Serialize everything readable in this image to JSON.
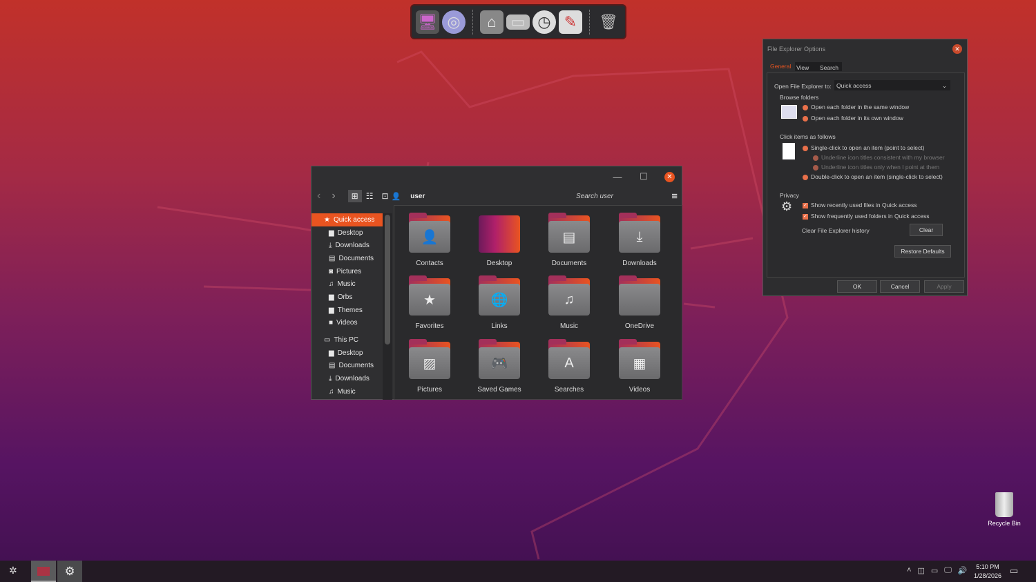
{
  "dock": {
    "items": [
      "monitor",
      "network-globe",
      "home-folder",
      "drive",
      "clock",
      "settings-tools",
      "trash"
    ]
  },
  "explorer": {
    "location": "user",
    "search_placeholder": "Search user",
    "sidebar": [
      {
        "label": "Quick access",
        "icon": "★",
        "active": true
      },
      {
        "label": "Desktop",
        "icon": "▆"
      },
      {
        "label": "Downloads",
        "icon": "⤓"
      },
      {
        "label": "Documents",
        "icon": "▤"
      },
      {
        "label": "Pictures",
        "icon": "◙"
      },
      {
        "label": "Music",
        "icon": "♫"
      },
      {
        "label": "Orbs",
        "icon": "▆"
      },
      {
        "label": "Themes",
        "icon": "▆"
      },
      {
        "label": "Videos",
        "icon": "■"
      }
    ],
    "sidebar_pc": [
      {
        "label": "This PC",
        "icon": "▭"
      },
      {
        "label": "Desktop",
        "icon": "▆"
      },
      {
        "label": "Documents",
        "icon": "▤"
      },
      {
        "label": "Downloads",
        "icon": "⤓"
      },
      {
        "label": "Music",
        "icon": "♫"
      }
    ],
    "folders": [
      {
        "label": "Contacts",
        "glyph": "👤"
      },
      {
        "label": "Desktop",
        "glyph": ""
      },
      {
        "label": "Documents",
        "glyph": "▤"
      },
      {
        "label": "Downloads",
        "glyph": "⤓"
      },
      {
        "label": "Favorites",
        "glyph": "★"
      },
      {
        "label": "Links",
        "glyph": "🌐"
      },
      {
        "label": "Music",
        "glyph": "♫"
      },
      {
        "label": "OneDrive",
        "glyph": ""
      },
      {
        "label": "Pictures",
        "glyph": "▨"
      },
      {
        "label": "Saved Games",
        "glyph": "🎮"
      },
      {
        "label": "Searches",
        "glyph": "A"
      },
      {
        "label": "Videos",
        "glyph": "▦"
      }
    ]
  },
  "options": {
    "title": "File Explorer Options",
    "tabs": [
      "General",
      "View",
      "Search"
    ],
    "open_to_label": "Open File Explorer to:",
    "open_to_value": "Quick access",
    "browse_heading": "Browse folders",
    "browse": [
      "Open each folder in the same window",
      "Open each folder in its own window"
    ],
    "click_heading": "Click items as follows",
    "single": "Single-click to open an item (point to select)",
    "underline1": "Underline icon titles consistent with my browser",
    "underline2": "Underline icon titles only when I point at them",
    "double": "Double-click to open an item (single-click to select)",
    "privacy_heading": "Privacy",
    "privacy": [
      "Show recently used files in Quick access",
      "Show frequently used folders in Quick access"
    ],
    "clear_label": "Clear File Explorer history",
    "clear_btn": "Clear",
    "restore_btn": "Restore Defaults",
    "ok": "OK",
    "cancel": "Cancel",
    "apply": "Apply"
  },
  "desktop": {
    "recycle_bin": "Recycle Bin"
  },
  "taskbar": {
    "time": "5:10 PM",
    "date": "1/28/2026"
  },
  "colors": {
    "accent": "#e95420"
  }
}
